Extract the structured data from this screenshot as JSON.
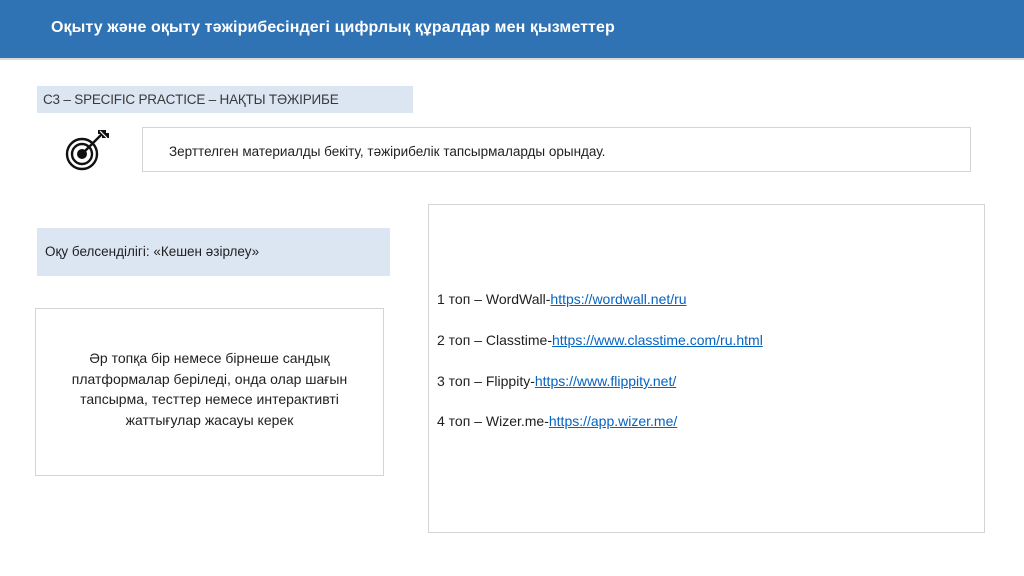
{
  "header": {
    "title": "Оқыту және оқыту тәжірибесіндегі цифрлық құралдар мен қызметтер"
  },
  "section": {
    "label": "C3 – SPECIFIC PRACTICE – НАҚТЫ ТӘЖІРИБЕ",
    "icon": "target-icon"
  },
  "description": "Зерттелген материалды бекіту, тәжірибелік тапсырмаларды орындау.",
  "activity": {
    "label": "Оқу белсенділігі: «Кешен әзірлеу»"
  },
  "task": {
    "text": "Әр топқа бір немесе бірнеше сандық платформалар беріледі, онда олар шағын тапсырма, тесттер немесе интерактивті жаттығулар жасауы керек"
  },
  "groups": [
    {
      "prefix": "1 топ – WordWall-",
      "url": "https://wordwall.net/ru"
    },
    {
      "prefix": "2 топ – Classtime-",
      "url": "https://www.classtime.com/ru.html"
    },
    {
      "prefix": "3 топ – Flippity-",
      "url": "https://www.flippity.net/"
    },
    {
      "prefix": "4 топ – Wizer.me-",
      "url": "https://app.wizer.me/"
    }
  ],
  "colors": {
    "header_bg": "#2f73b5",
    "label_bg": "#dce6f2",
    "link": "#0563c1"
  }
}
